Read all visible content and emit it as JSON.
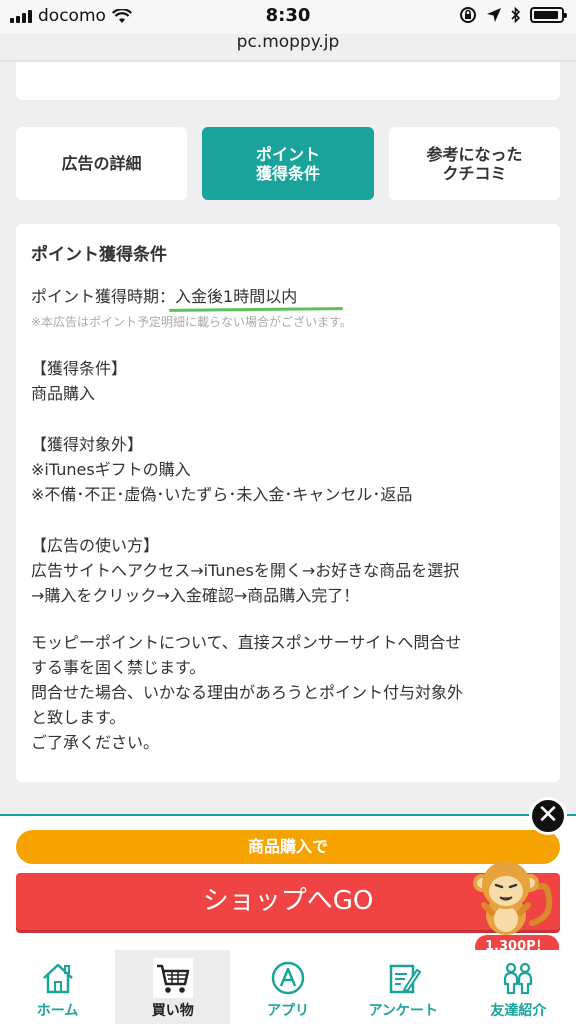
{
  "status_bar": {
    "carrier": "docomo",
    "time": "8:30",
    "url": "pc.moppy.jp"
  },
  "tabs": [
    {
      "label": "広告の詳細",
      "active": false
    },
    {
      "label": "ポイント\n獲得条件",
      "active": true
    },
    {
      "label": "参考になった\nクチコミ",
      "active": false
    }
  ],
  "content": {
    "title": "ポイント獲得条件",
    "timing_label": "ポイント獲得時期：",
    "timing_value": "入金後1時間以内",
    "note": "※本広告はポイント予定明細に載らない場合がございます。",
    "conditions_heading": "【獲得条件】",
    "conditions_text": "商品購入",
    "exclusions_heading": "【獲得対象外】",
    "exclusions_line1": "※iTunesギフトの購入",
    "exclusions_line2": "※不備･不正･虚偽･いたずら･未入金･キャンセル･返品",
    "usage_heading": "【広告の使い方】",
    "usage_line1": "広告サイトへアクセス→iTunesを開く→お好きな商品を選択",
    "usage_line2": "→購入をクリック→入金確認→商品購入完了！",
    "warning_line1": "モッピーポイントについて、直接スポンサーサイトへ問合せ",
    "warning_line2": "する事を固く禁じます。",
    "warning_line3": "問合せた場合、いかなる理由があろうとポイント付与対象外",
    "warning_line4": "と致します。",
    "warning_line5": "ご了承ください。"
  },
  "promo": {
    "condition_pill": "商品購入で",
    "shop_button": "ショップへGO",
    "points_badge": "1,300P！",
    "close_glyph": "✕"
  },
  "bottom_nav": [
    {
      "label": "ホーム",
      "icon": "home-icon",
      "active": false
    },
    {
      "label": "買い物",
      "icon": "cart-icon",
      "active": true
    },
    {
      "label": "アプリ",
      "icon": "app-icon",
      "active": false
    },
    {
      "label": "アンケート",
      "icon": "survey-icon",
      "active": false
    },
    {
      "label": "友達紹介",
      "icon": "friends-icon",
      "active": false
    }
  ],
  "colors": {
    "accent": "#1aa39a",
    "shop_button": "#f04444",
    "pill": "#f6a300",
    "underline": "#5dc05a"
  }
}
